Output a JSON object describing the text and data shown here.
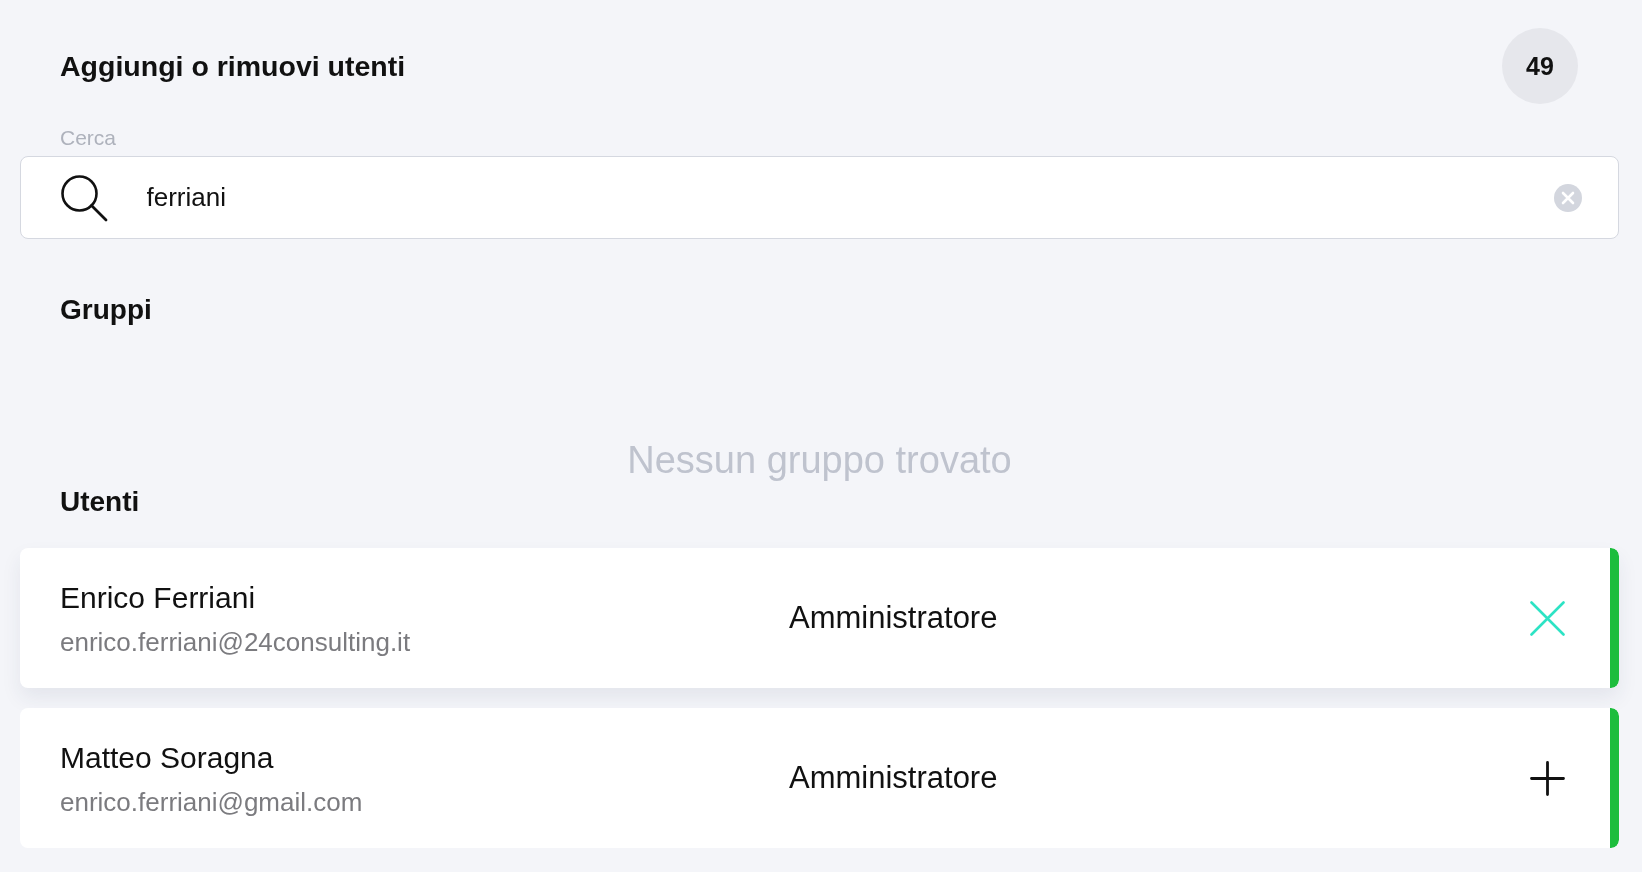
{
  "header": {
    "title": "Aggiungi o rimuovi utenti",
    "count": "49"
  },
  "search": {
    "label": "Cerca",
    "value": "ferriani"
  },
  "groups": {
    "title": "Gruppi",
    "empty_message": "Nessun gruppo trovato"
  },
  "users": {
    "title": "Utenti",
    "rows": [
      {
        "name": "Enrico Ferriani",
        "email": "enrico.ferriani@24consulting.it",
        "role": "Amministratore",
        "added": true
      },
      {
        "name": "Matteo Soragna",
        "email": "enrico.ferriani@gmail.com",
        "role": "Amministratore",
        "added": false
      }
    ]
  }
}
